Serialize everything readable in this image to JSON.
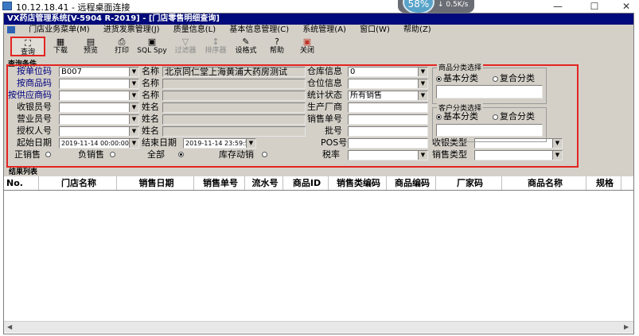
{
  "rdp": {
    "title": "10.12.18.41 - 远程桌面连接",
    "meter_percent": "58%",
    "meter_speed": "↓ 0.5K/s",
    "minimize": "—",
    "maximize": "☐",
    "close": "✕"
  },
  "app": {
    "title": "VX药店管理系统[V-5904 R-2019] - [门店零售明细查询]"
  },
  "menu": [
    "门店业务菜单(M)",
    "进货发票管理(J)",
    "质量信息(L)",
    "基本信息管理(C)",
    "系统管理(A)",
    "窗口(W)",
    "帮助(Z)"
  ],
  "toolbar": [
    {
      "label": "查询",
      "icon": "binoculars-icon",
      "glyph": "⛶"
    },
    {
      "label": "下载",
      "icon": "download-icon",
      "glyph": "▦"
    },
    {
      "label": "预览",
      "icon": "preview-icon",
      "glyph": "▤"
    },
    {
      "label": "打印",
      "icon": "printer-icon",
      "glyph": "⎙"
    },
    {
      "label": "SQL Spy",
      "icon": "sql-spy-icon",
      "glyph": "▣"
    },
    {
      "label": "过滤器",
      "icon": "filter-icon",
      "glyph": "▽"
    },
    {
      "label": "排序器",
      "icon": "sort-icon",
      "glyph": "↕"
    },
    {
      "label": "设格式",
      "icon": "format-icon",
      "glyph": "✎"
    },
    {
      "label": "帮助",
      "icon": "help-icon",
      "glyph": "?"
    },
    {
      "label": "关闭",
      "icon": "close-icon",
      "glyph": "▣"
    }
  ],
  "conditions_title": "查询条件",
  "form": {
    "unit_code_label": "按单位码",
    "unit_code_value": "B007",
    "name1_label": "名称",
    "name1_value": "北京同仁堂上海黄浦大药房测试",
    "warehouse_label": "仓库信息",
    "warehouse_value": "0",
    "product_code_label": "按商品码",
    "name2_label": "名称",
    "location_label": "仓位信息",
    "supplier_code_label": "按供应商码",
    "name3_label": "名称",
    "stat_state_label": "统计状态",
    "stat_state_value": "所有销售",
    "cashier_label": "收银员号",
    "name4_label": "姓名",
    "manufacturer_label": "生产厂商",
    "clerk_label": "营业员号",
    "name5_label": "姓名",
    "sales_no_label": "销售单号",
    "authorizer_label": "授权人号",
    "name6_label": "姓名",
    "batch_label": "批号",
    "start_date_label": "起始日期",
    "start_date_value": "2019-11-14 00:00:00",
    "end_date_label": "结束日期",
    "end_date_value": "2019-11-14 23:59:59",
    "pos_label": "POS号",
    "register_type_label": "收银类型",
    "tax_rate_label": "税率",
    "sales_type_label": "销售类型",
    "radio_normal": "正销售",
    "radio_negative": "负销售",
    "radio_all": "全部",
    "radio_stock": "库存动销"
  },
  "product_class": {
    "title": "商品分类选择",
    "basic": "基本分类",
    "compound": "复合分类"
  },
  "customer_class": {
    "title": "客户分类选择",
    "basic": "基本分类",
    "compound": "复合分类"
  },
  "result": {
    "title": "结果列表",
    "columns": [
      "No.",
      "门店名称",
      "销售日期",
      "销售单号",
      "流水号",
      "商品ID",
      "销售类编码",
      "商品编码",
      "厂家码",
      "商品名称",
      "规格"
    ]
  }
}
